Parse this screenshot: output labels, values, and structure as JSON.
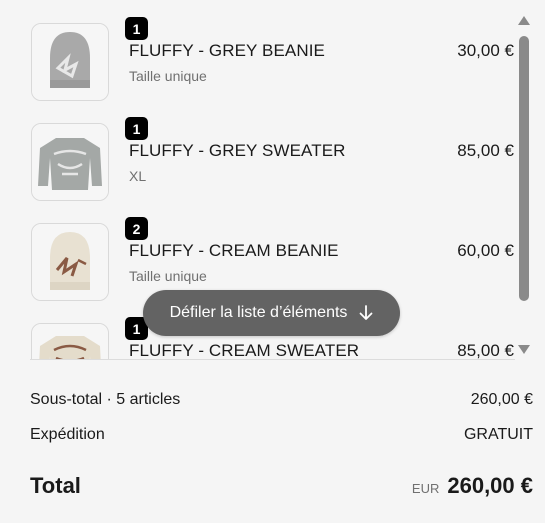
{
  "cart": {
    "items": [
      {
        "quantity": "1",
        "name": "FLUFFY - GREY BEANIE",
        "variant": "Taille unique",
        "price": "30,00 €",
        "image_icon": "grey-beanie-image"
      },
      {
        "quantity": "1",
        "name": "FLUFFY - GREY SWEATER",
        "variant": "XL",
        "price": "85,00 €",
        "image_icon": "grey-sweater-image"
      },
      {
        "quantity": "2",
        "name": "FLUFFY - CREAM BEANIE",
        "variant": "Taille unique",
        "price": "60,00 €",
        "image_icon": "cream-beanie-image"
      },
      {
        "quantity": "1",
        "name": "FLUFFY - CREAM SWEATER",
        "variant": "",
        "price": "85,00 €",
        "image_icon": "cream-sweater-image"
      }
    ],
    "scroll_hint": {
      "label": "Défiler la liste d’éléments",
      "icon": "arrow-down-icon"
    }
  },
  "summary": {
    "subtotal_label": "Sous-total · 5 articles",
    "subtotal_value": "260,00 €",
    "shipping_label": "Expédition",
    "shipping_value": "GRATUIT",
    "total_label": "Total",
    "currency": "EUR",
    "total_value": "260,00 €"
  },
  "colors": {
    "background": "#f5f5f5",
    "badge": "#000000",
    "pill": "#636363",
    "muted_text": "#707070"
  }
}
